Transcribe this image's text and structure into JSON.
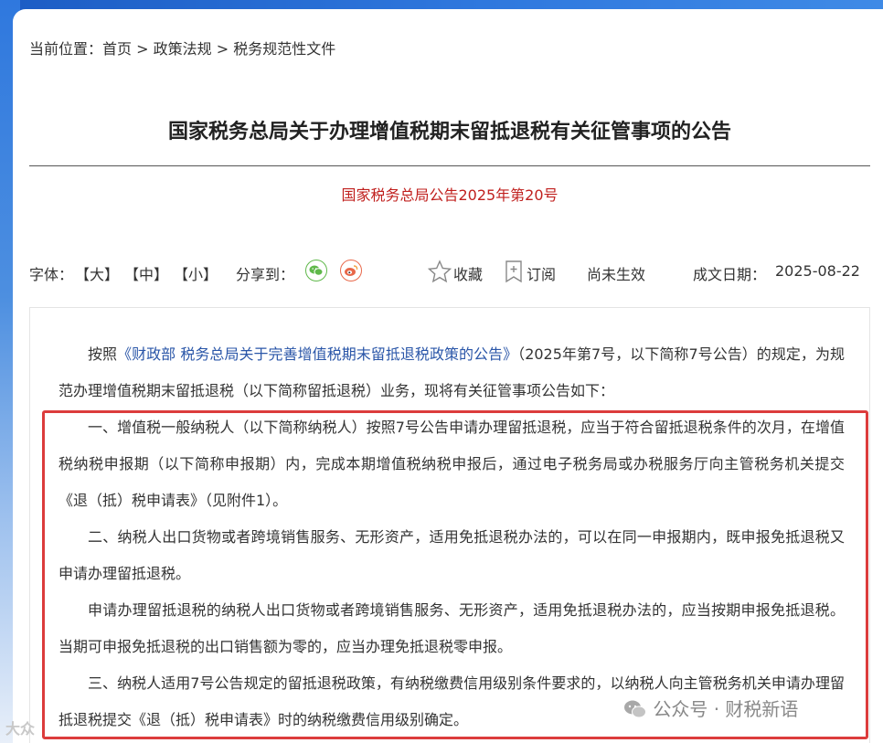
{
  "breadcrumb": {
    "prefix": "当前位置：",
    "home": "首页",
    "sep": " > ",
    "level1": "政策法规",
    "level2": "税务规范性文件"
  },
  "article": {
    "title": "国家税务总局关于办理增值税期末留抵退税有关征管事项的公告",
    "doc_number": "国家税务总局公告2025年第20号"
  },
  "toolbar": {
    "font_label": "字体：",
    "font_large": "【大】",
    "font_medium": "【中】",
    "font_small": "【小】",
    "share_label": "分享到：",
    "favorite": "收藏",
    "subscribe": "订阅",
    "status": "尚未生效",
    "date_label": "成文日期：",
    "date_value": "2025-08-22"
  },
  "content": {
    "p1_before": "按照",
    "p1_link": "《财政部 税务总局关于完善增值税期末留抵退税政策的公告》",
    "p1_after": "（2025年第7号，以下简称7号公告）的规定，为规范办理增值税期末留抵退税（以下简称留抵退税）业务，现将有关征管事项公告如下：",
    "p2": "一、增值税一般纳税人（以下简称纳税人）按照7号公告申请办理留抵退税，应当于符合留抵退税条件的次月，在增值税纳税申报期（以下简称申报期）内，完成本期增值税纳税申报后，通过电子税务局或办税服务厅向主管税务机关提交《退（抵）税申请表》（见附件1）。",
    "p3": "二、纳税人出口货物或者跨境销售服务、无形资产，适用免抵退税办法的，可以在同一申报期内，既申报免抵退税又申请办理留抵退税。",
    "p4": "申请办理留抵退税的纳税人出口货物或者跨境销售服务、无形资产，适用免抵退税办法的，应当按期申报免抵退税。当期可申报免抵退税的出口销售额为零的，应当办理免抵退税零申报。",
    "p5": "三、纳税人适用7号公告规定的留抵退税政策，有纳税缴费信用级别条件要求的，以纳税人向主管税务机关申请办理留抵退税提交《退（抵）税申请表》时的纳税缴费信用级别确定。"
  },
  "watermark": {
    "text": "公众号 · 财税新语",
    "corner_text": "大众"
  },
  "colors": {
    "accent_red": "#c0201e",
    "highlight_border": "#dc3c3c",
    "link_blue": "#2a56a8",
    "wechat_green": "#5fb84a",
    "weibo_orange": "#e8684a",
    "header_blue": "#2f78de"
  },
  "icons": [
    "wechat-icon",
    "weibo-icon",
    "star-icon",
    "bookmark-plus-icon"
  ]
}
